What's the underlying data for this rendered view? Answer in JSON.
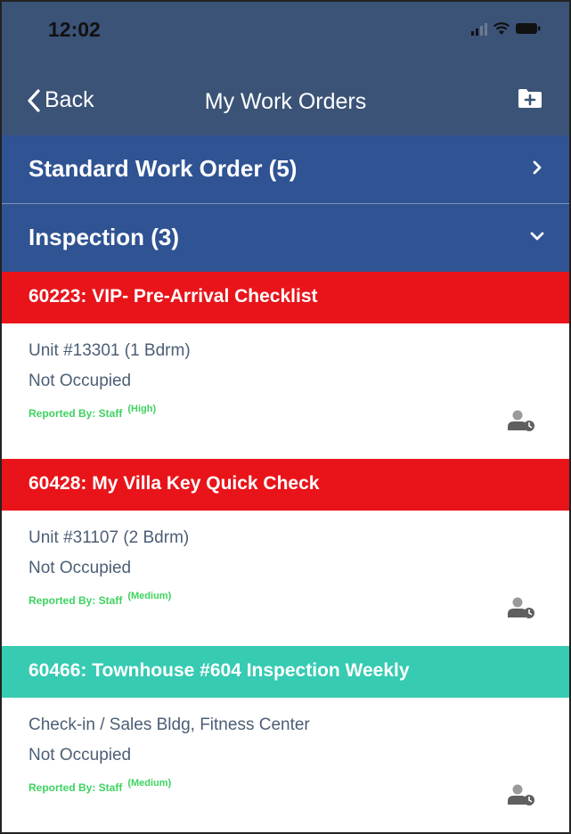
{
  "status_bar": {
    "time": "12:02"
  },
  "nav": {
    "back_label": "Back",
    "title": "My Work Orders",
    "new_icon": "add-folder-icon"
  },
  "sections": [
    {
      "label": "Standard Work Order (5)",
      "chevron": "chevron-right-icon"
    },
    {
      "label": "Inspection (3)",
      "chevron": "chevron-down-icon"
    }
  ],
  "orders": [
    {
      "title": "60223: VIP- Pre-Arrival Checklist",
      "color": "#e8141a",
      "location": "Unit #13301 (1 Bdrm)",
      "occupancy": "Not Occupied",
      "reported_by": "Reported By: Staff",
      "priority": "(High)",
      "icon": "assign-user-icon"
    },
    {
      "title": "60428: My Villa Key Quick Check",
      "color": "#e8141a",
      "location": "Unit #31107 (2 Bdrm)",
      "occupancy": "Not Occupied",
      "reported_by": "Reported By: Staff",
      "priority": "(Medium)",
      "icon": "assign-user-icon"
    },
    {
      "title": "60466: Townhouse #604 Inspection Weekly",
      "color": "#36cbb2",
      "location": "Check-in / Sales Bldg, Fitness Center",
      "occupancy": "Not Occupied",
      "reported_by": "Reported By: Staff",
      "priority": "(Medium)",
      "icon": "assign-user-icon"
    }
  ]
}
